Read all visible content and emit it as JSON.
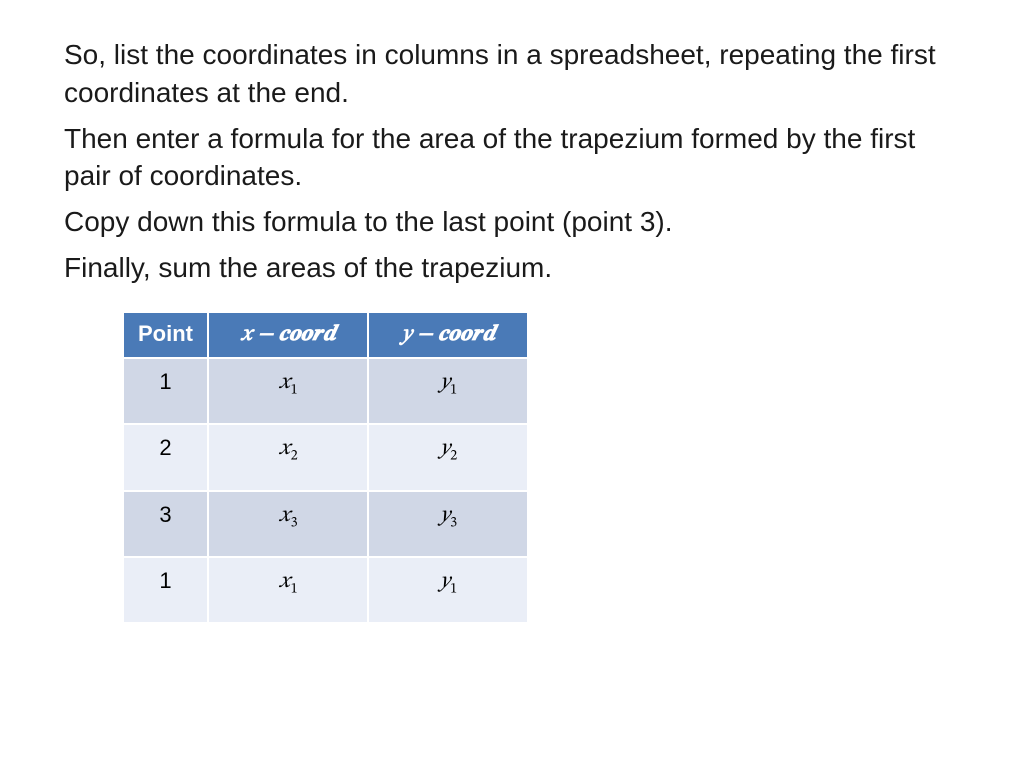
{
  "paragraphs": {
    "p1": "So, list the coordinates in columns in a spreadsheet, repeating the first coordinates at the end.",
    "p2": "Then enter a formula for the area of the trapezium formed by the first pair of coordinates.",
    "p3": "Copy down this formula to the last point (point 3).",
    "p4": "Finally, sum the areas of the trapezium."
  },
  "table": {
    "headers": {
      "point": "Point",
      "xcoord_pre": "𝑥 − ",
      "xcoord_word": "𝒄𝒐𝒐𝒓𝒅",
      "ycoord_pre": "𝑦 − ",
      "ycoord_word": "𝒄𝒐𝒐𝒓𝒅"
    },
    "rows": [
      {
        "point": "1",
        "xbase": "𝑥",
        "xsub": "1",
        "ybase": "𝑦",
        "ysub": "1"
      },
      {
        "point": "2",
        "xbase": "𝑥",
        "xsub": "2",
        "ybase": "𝑦",
        "ysub": "2"
      },
      {
        "point": "3",
        "xbase": "𝑥",
        "xsub": "3",
        "ybase": "𝑦",
        "ysub": "3"
      },
      {
        "point": "1",
        "xbase": "𝑥",
        "xsub": "1",
        "ybase": "𝑦",
        "ysub": "1"
      }
    ]
  }
}
